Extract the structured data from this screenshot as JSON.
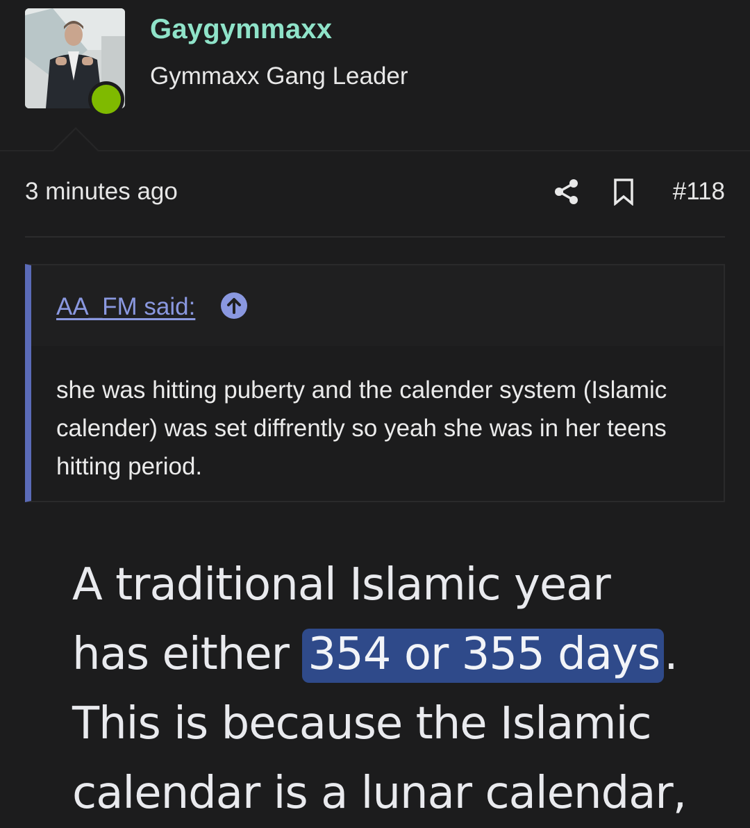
{
  "user": {
    "name": "Gaygymmaxx",
    "title": "Gymmaxx Gang Leader",
    "online": true,
    "accent_color": "#8fe3c9",
    "status_color": "#7fba00"
  },
  "post": {
    "time": "3 minutes ago",
    "number": "#118",
    "icons": [
      "share-icon",
      "bookmark-icon"
    ]
  },
  "quote": {
    "author": "AA_FM said:",
    "text": "she was hitting puberty and the calender system (Islamic calender) was set diffrently so yeah she was in her teens hitting period.",
    "bar_color": "#5b6bb8"
  },
  "image_text": {
    "line1": "A traditional Islamic year",
    "line2_prefix": "has either ",
    "line2_highlight": "354 or 355 days",
    "line2_suffix": ".",
    "line3": "This is because the Islamic",
    "line4": "calendar is a lunar calendar,",
    "highlight_color": "#2f4a8a"
  }
}
